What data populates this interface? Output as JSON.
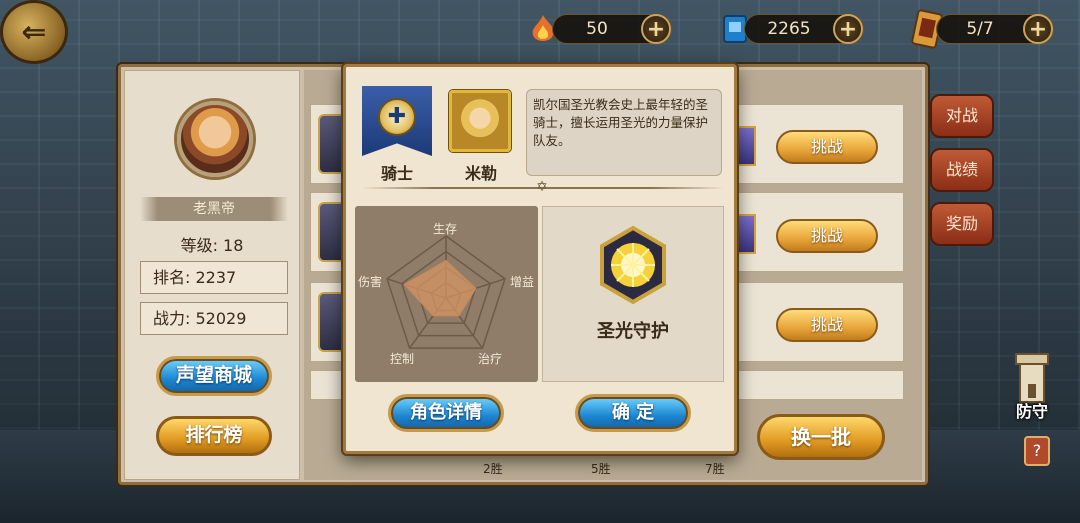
{
  "topbar": {
    "back_icon": "back-arrow-icon",
    "resources": [
      {
        "icon": "flame-icon",
        "value": "50"
      },
      {
        "icon": "book-icon",
        "value": "2265"
      },
      {
        "icon": "ticket-icon",
        "value": "5/7"
      }
    ],
    "plus_symbol": "+"
  },
  "player": {
    "name": "老黑帝",
    "level_text": "等级: 18",
    "rank_text": "排名: 2237",
    "power_text": "战力: 52029"
  },
  "left_buttons": {
    "shop": "声望商城",
    "leaderboard": "排行榜"
  },
  "list": {
    "challenge_label": "挑战",
    "rows": [
      {
        "challenge": "挑战"
      },
      {
        "challenge": "挑战"
      },
      {
        "challenge": "挑战"
      }
    ],
    "replace_button": "换一批",
    "win_milestones": [
      "2胜",
      "5胜",
      "7胜"
    ]
  },
  "side_tabs": [
    "对战",
    "战绩",
    "奖励"
  ],
  "defense_label": "防守",
  "dialog": {
    "class_label": "骑士",
    "hero_name": "米勒",
    "description": "凯尔国圣光教会史上最年轻的圣骑士，擅长运用圣光的力量保护队友。",
    "radar": {
      "axes": [
        "生存",
        "增益",
        "治疗",
        "控制",
        "伤害"
      ],
      "values": [
        0.6,
        0.5,
        0.35,
        0.35,
        0.7
      ]
    },
    "skill_name": "圣光守护",
    "detail_button": "角色详情",
    "confirm_button": "确 定"
  }
}
